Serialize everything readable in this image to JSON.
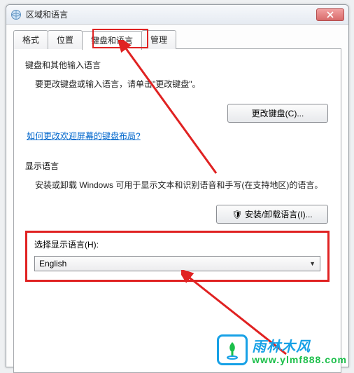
{
  "window": {
    "title": "区域和语言"
  },
  "tabs": {
    "items": [
      {
        "label": "格式"
      },
      {
        "label": "位置"
      },
      {
        "label": "键盘和语言"
      },
      {
        "label": "管理"
      }
    ]
  },
  "keyboard_section": {
    "title": "键盘和其他输入语言",
    "desc": "要更改键盘或输入语言，请单击\"更改键盘\"。",
    "change_btn": "更改键盘(C)...",
    "link": "如何更改欢迎屏幕的键盘布局?"
  },
  "display_section": {
    "title": "显示语言",
    "desc": "安装或卸载 Windows 可用于显示文本和识别语音和手写(在支持地区)的语言。",
    "install_btn": "🛡 安装/卸载语言(I)..."
  },
  "dropdown": {
    "label": "选择显示语言(H):",
    "value": "English"
  },
  "watermark": {
    "line1": "雨林木风",
    "line2": "www.ylmf888.com"
  }
}
